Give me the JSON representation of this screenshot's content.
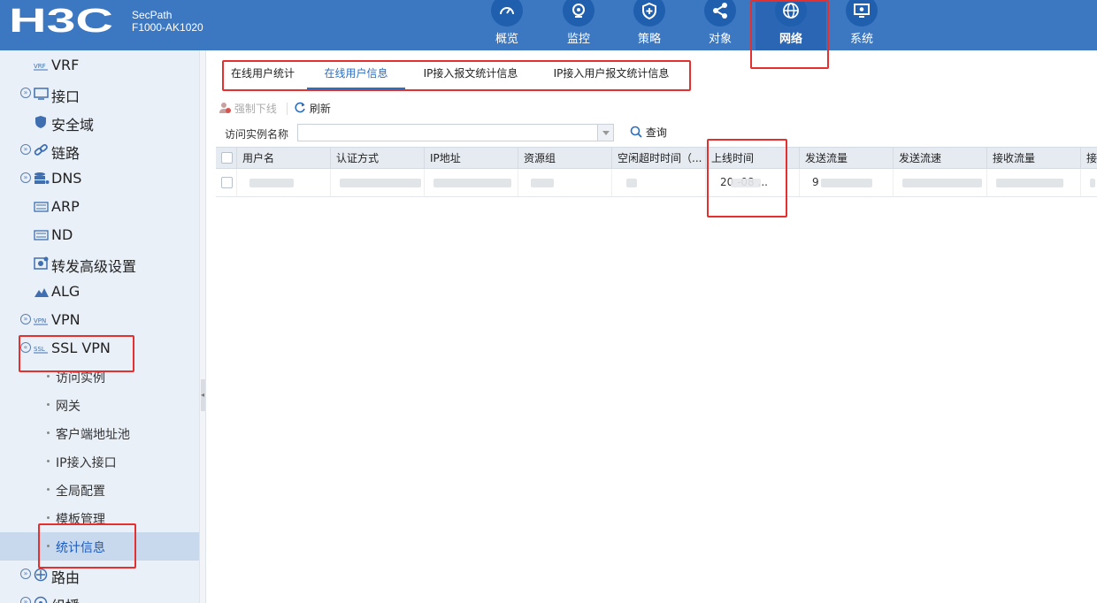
{
  "header": {
    "brand": "H3C",
    "product_line": "SecPath",
    "model": "F1000-AK1020",
    "nav": [
      {
        "label": "概览",
        "icon": "gauge-icon"
      },
      {
        "label": "监控",
        "icon": "monitor-eye-icon"
      },
      {
        "label": "策略",
        "icon": "shield-plus-icon"
      },
      {
        "label": "对象",
        "icon": "share-nodes-icon"
      },
      {
        "label": "网络",
        "icon": "globe-icon",
        "active": true
      },
      {
        "label": "系统",
        "icon": "screen-gear-icon"
      }
    ]
  },
  "sidebar": {
    "items": [
      {
        "label": "VRF",
        "icon": "vrf-icon",
        "expandable": false
      },
      {
        "label": "接口",
        "icon": "interface-icon",
        "expandable": true
      },
      {
        "label": "安全域",
        "icon": "shield-icon",
        "expandable": false
      },
      {
        "label": "链路",
        "icon": "link-icon",
        "expandable": true
      },
      {
        "label": "DNS",
        "icon": "dns-icon",
        "expandable": true
      },
      {
        "label": "ARP",
        "icon": "arp-icon",
        "expandable": false
      },
      {
        "label": "ND",
        "icon": "nd-icon",
        "expandable": false
      },
      {
        "label": "转发高级设置",
        "icon": "forward-settings-icon",
        "expandable": false
      },
      {
        "label": "ALG",
        "icon": "alg-icon",
        "expandable": false
      },
      {
        "label": "VPN",
        "icon": "vpn-icon",
        "expandable": true
      },
      {
        "label": "SSL VPN",
        "icon": "ssl-vpn-icon",
        "expandable": true,
        "expanded": true
      }
    ],
    "ssl_vpn_children": [
      {
        "label": "访问实例"
      },
      {
        "label": "网关"
      },
      {
        "label": "客户端地址池"
      },
      {
        "label": "IP接入接口"
      },
      {
        "label": "全局配置"
      },
      {
        "label": "模板管理"
      },
      {
        "label": "统计信息",
        "active": true
      }
    ],
    "after": [
      {
        "label": "路由",
        "icon": "route-icon",
        "expandable": true
      },
      {
        "label": "组播",
        "icon": "multicast-icon",
        "expandable": true
      }
    ]
  },
  "tabs": [
    {
      "label": "在线用户统计"
    },
    {
      "label": "在线用户信息",
      "active": true
    },
    {
      "label": "IP接入报文统计信息"
    },
    {
      "label": "IP接入用户报文统计信息"
    }
  ],
  "toolbar": {
    "force_offline": "强制下线",
    "refresh": "刷新"
  },
  "filter": {
    "label": "访问实例名称",
    "value": "",
    "query": "查询"
  },
  "table": {
    "columns": [
      "用户名",
      "认证方式",
      "IP地址",
      "资源组",
      "空闲超时时间（...",
      "上线时间",
      "发送流量",
      "发送流速",
      "接收流量",
      "接"
    ],
    "rows": [
      {
        "login_time_visible": "20      -08 ...",
        "send_traffic_visible": "9"
      }
    ]
  },
  "colors": {
    "header_bg": "#3c78c2",
    "nav_circle": "#1f5fae",
    "sidebar_bg": "#eaf0f8",
    "active_blue": "#2c6fbd",
    "highlight_red": "#e53030"
  }
}
